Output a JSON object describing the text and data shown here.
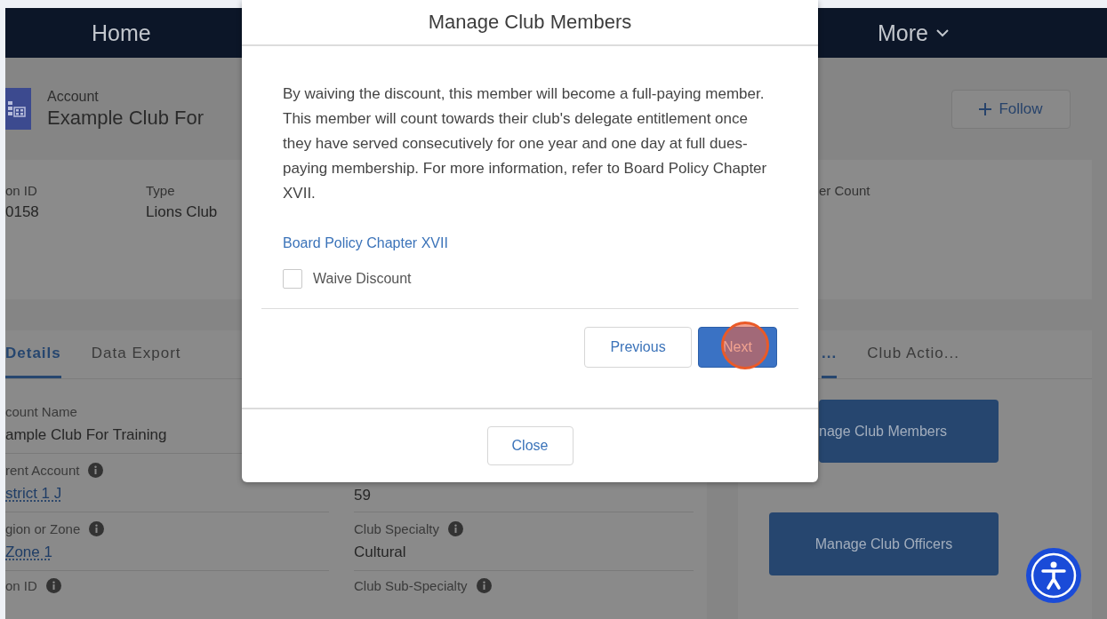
{
  "nav": {
    "items": [
      {
        "label": "Home",
        "dropdown": false
      },
      {
        "label": "More",
        "dropdown": true
      }
    ]
  },
  "record": {
    "object_type": "Account",
    "title": "Example Club For",
    "follow_button": "Follow"
  },
  "highlights": [
    {
      "label": "on ID",
      "value": "0158"
    },
    {
      "label": "Type",
      "value": "Lions Club"
    },
    {
      "label": "er Count"
    }
  ],
  "details_card": {
    "tabs": [
      {
        "label": "Details",
        "selected": true
      },
      {
        "label": "Data Export",
        "selected": false
      }
    ],
    "column_1": [
      {
        "label": "count Name",
        "info": false,
        "value": "ample Club For Training",
        "link": false
      },
      {
        "label": "rent Account",
        "info": true,
        "value": "strict 1 J",
        "link": true
      },
      {
        "label": "gion or Zone",
        "info": true,
        "value": "Zone 1",
        "link": true
      },
      {
        "label": "on ID",
        "info": true
      }
    ],
    "column_2": [
      {
        "value": "59",
        "link": false
      },
      {
        "label": "Club Specialty",
        "info": true,
        "value": "Cultural",
        "link": false
      },
      {
        "label": "Club Sub-Specialty",
        "info": true
      }
    ]
  },
  "actions_card": {
    "tabs": [
      {
        "label": "...",
        "selected": true
      },
      {
        "label": "Club Actio...",
        "selected": false
      }
    ],
    "buttons": [
      "nage Club Members",
      "Manage Club Officers"
    ]
  },
  "modal": {
    "title": "Manage Club Members",
    "message": "By waiving the discount, this member will become a full-paying member. This member will count towards their club's delegate entitlement once they have served consecutively for one year and one day at full dues-paying membership. For more information, refer to Board Policy Chapter XVII.",
    "link": "Board Policy Chapter XVII",
    "checkbox": {
      "label": "Waive Discount",
      "checked": false
    },
    "buttons": [
      {
        "label": "Previous",
        "kind": "neutral"
      },
      {
        "label": "Next",
        "kind": "brand"
      }
    ],
    "close_button": "Close"
  }
}
